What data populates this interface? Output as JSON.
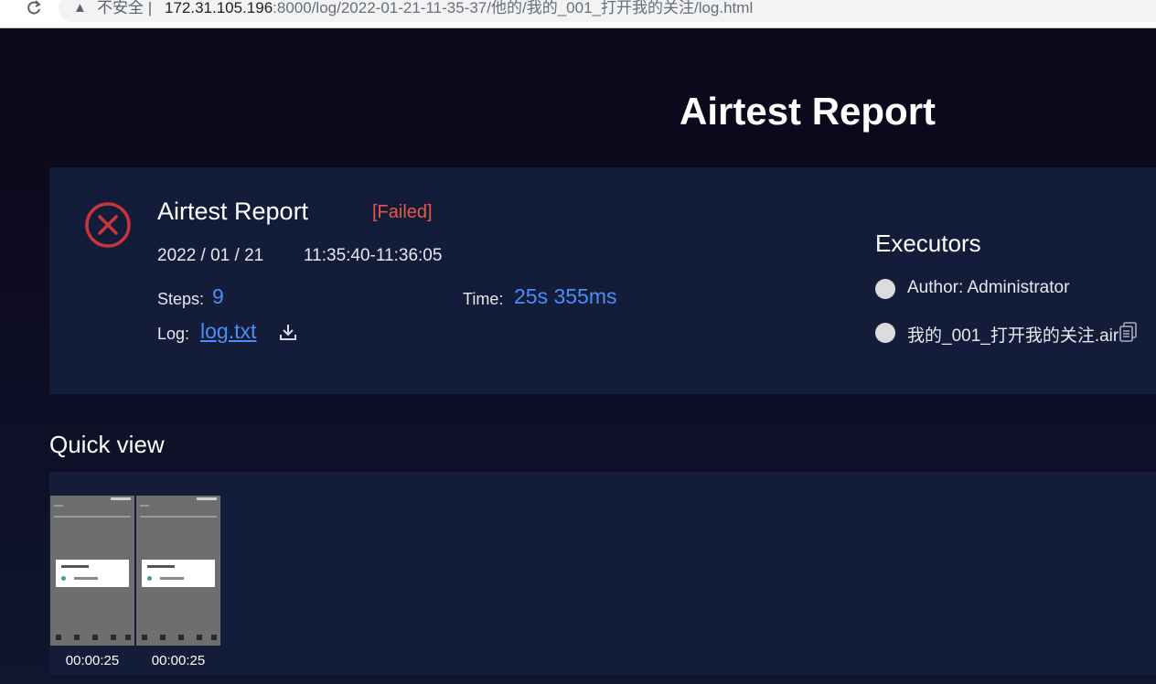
{
  "browser": {
    "security_label": "不安全",
    "separator": "|",
    "url_host": "172.31.105.196",
    "url_rest": ":8000/log/2022-01-21-11-35-37/他的/我的_001_打开我的关注/log.html"
  },
  "page": {
    "title": "Airtest Report"
  },
  "summary": {
    "report_title": "Airtest Report",
    "status": "[Failed]",
    "date": "2022 / 01 / 21",
    "time_range": "11:35:40-11:36:05",
    "steps_label": "Steps:",
    "steps_value": "9",
    "duration_label": "Time:",
    "duration_value": "25s 355ms",
    "log_label": "Log:",
    "log_link": "log.txt",
    "status_color": "#e8584a",
    "accent_color": "#4b8ef5"
  },
  "executors": {
    "title": "Executors",
    "items": [
      {
        "label": "Author: Administrator"
      },
      {
        "label": "我的_001_打开我的关注.air"
      }
    ]
  },
  "quick_view": {
    "title": "Quick view",
    "thumbnails": [
      {
        "time": "00:00:25"
      },
      {
        "time": "00:00:25"
      }
    ]
  },
  "icons": {
    "failed": "circle-x-icon",
    "download": "download-icon",
    "copy": "copy-icon",
    "reload": "reload-icon",
    "warning": "warning-icon"
  }
}
